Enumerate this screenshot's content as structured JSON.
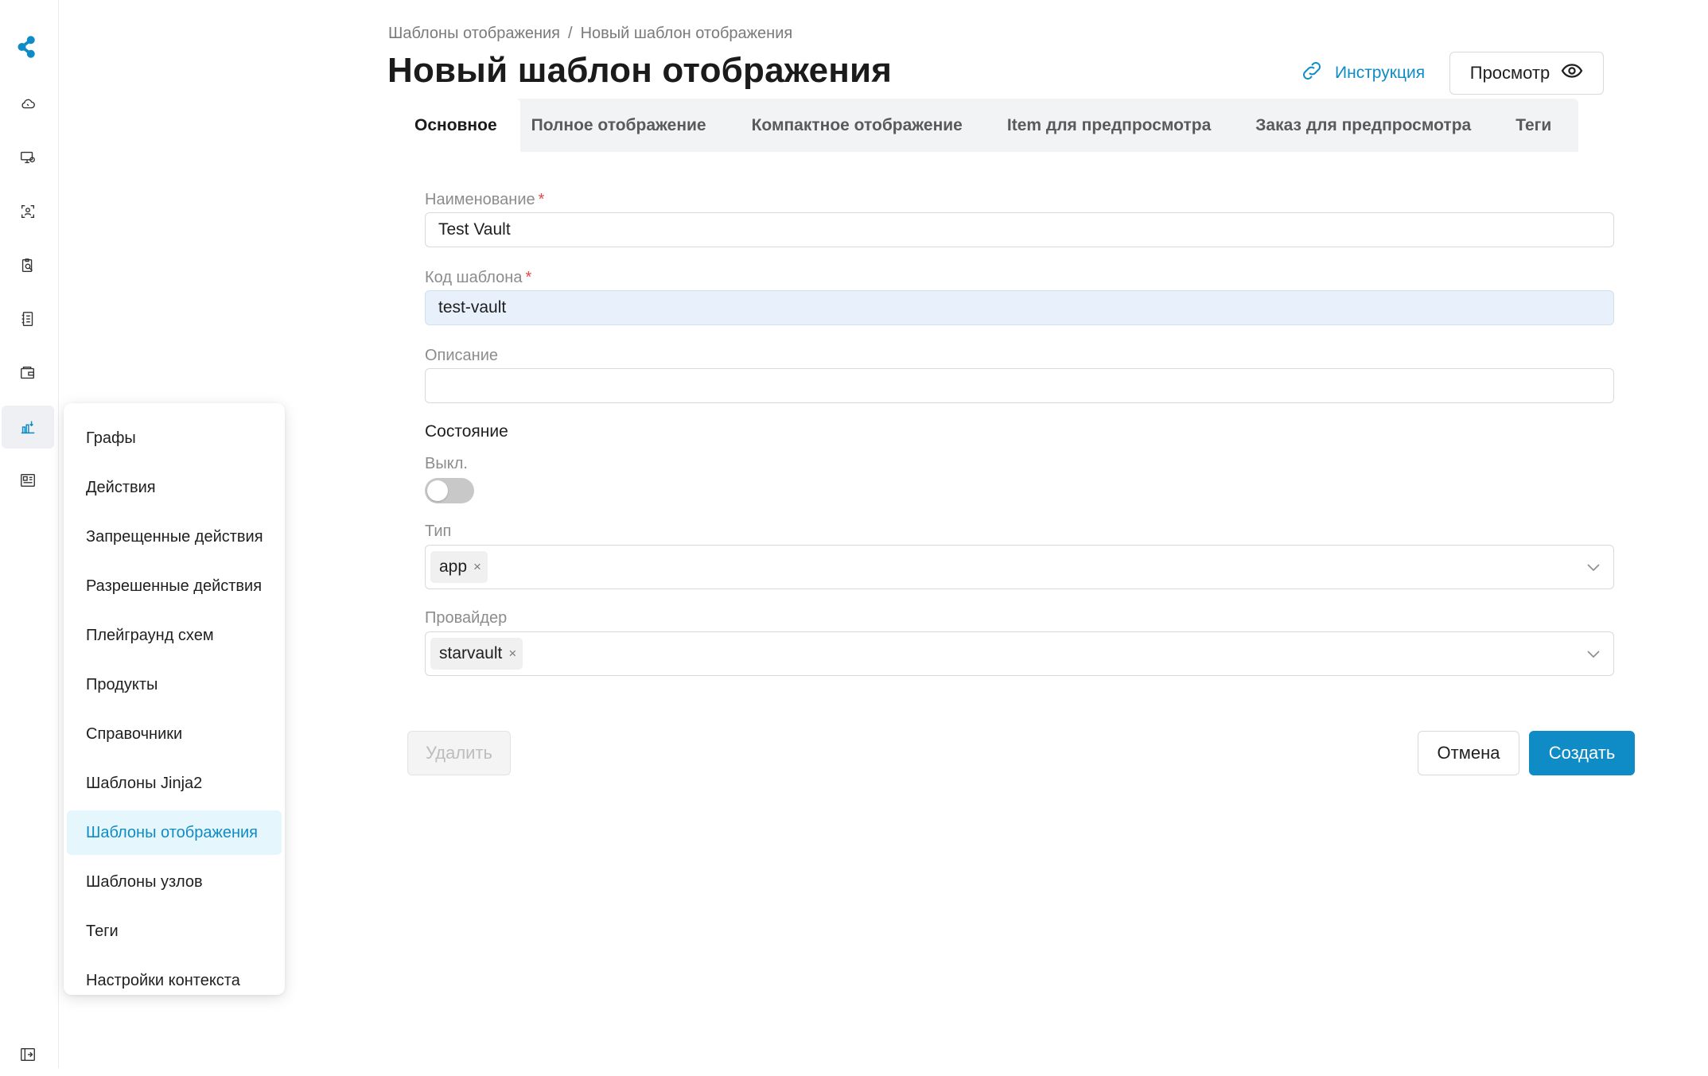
{
  "breadcrumb": {
    "parent": "Шаблоны отображения",
    "separator": "/",
    "current": "Новый шаблон отображения"
  },
  "page": {
    "title": "Новый шаблон отображения"
  },
  "header": {
    "instruction_label": "Инструкция",
    "preview_label": "Просмотр"
  },
  "tabs": [
    {
      "label": "Основное",
      "active": true
    },
    {
      "label": "Полное отображение"
    },
    {
      "label": "Компактное отображение"
    },
    {
      "label": "Item для предпросмотра"
    },
    {
      "label": "Заказ для предпросмотра"
    },
    {
      "label": "Теги"
    }
  ],
  "form": {
    "name_label": "Наименование",
    "name_value": "Test Vault",
    "code_label": "Код шаблона",
    "code_value": "test-vault",
    "description_label": "Описание",
    "description_value": "",
    "required_mark": "*",
    "state_section": "Состояние",
    "state_value": "Выкл.",
    "state_on": false,
    "type_label": "Тип",
    "type_tags": [
      "app"
    ],
    "provider_label": "Провайдер",
    "provider_tags": [
      "starvault"
    ],
    "tag_remove_glyph": "×"
  },
  "actions": {
    "delete_label": "Удалить",
    "cancel_label": "Отмена",
    "create_label": "Создать"
  },
  "sidebar": {
    "icons": [
      "logo-icon",
      "cloud-icon",
      "monitor-settings-icon",
      "user-frame-icon",
      "clipboard-search-icon",
      "notebook-icon",
      "wallet-icon",
      "chart-icon",
      "grid-list-icon",
      "collapse-sidebar-icon"
    ],
    "active_icon": "chart-icon"
  },
  "menu": {
    "items": [
      "Графы",
      "Действия",
      "Запрещенные действия",
      "Разрешенные действия",
      "Плейграунд схем",
      "Продукты",
      "Справочники",
      "Шаблоны Jinja2",
      "Шаблоны отображения",
      "Шаблоны узлов",
      "Теги",
      "Настройки контекста"
    ],
    "active_item": "Шаблоны отображения"
  },
  "colors": {
    "accent": "#0f8bc6",
    "active_menu_bg": "#e6f6fd",
    "tabs_bg": "#f2f3f5",
    "required": "#e5484d",
    "focused_input_bg": "#e8f1fb"
  }
}
